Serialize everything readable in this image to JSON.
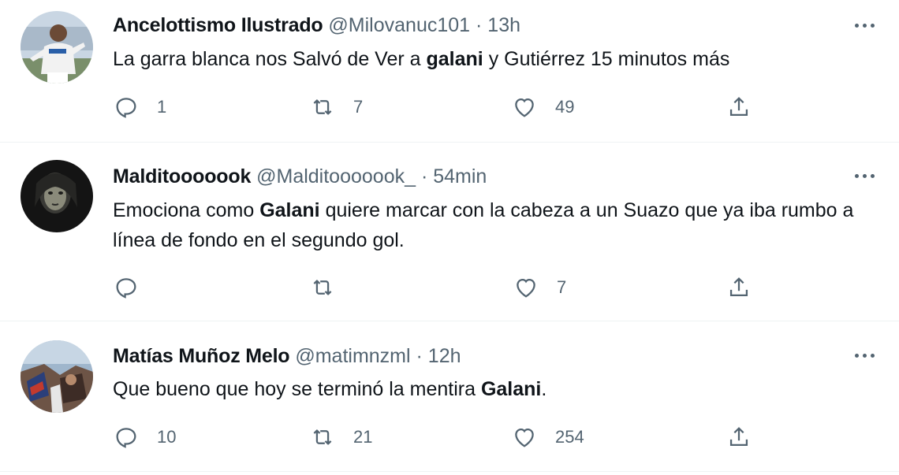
{
  "tweets": [
    {
      "name": "Ancelottismo Ilustrado",
      "handle": "@Milovanuc101",
      "separator": "·",
      "time": "13h",
      "text_before": "La garra blanca nos Salvó de Ver a ",
      "text_bold": "galani",
      "text_after": " y Gutiérrez 15 minutos más",
      "replies": "1",
      "retweets": "7",
      "likes": "49"
    },
    {
      "name": "Malditooooook",
      "handle": "@Malditooooook_",
      "separator": "·",
      "time": "54min",
      "text_before": "Emociona como ",
      "text_bold": "Galani",
      "text_after": " quiere marcar con la cabeza a un Suazo que ya iba rumbo a línea de fondo en el segundo gol.",
      "replies": "",
      "retweets": "",
      "likes": "7"
    },
    {
      "name": "Matías Muñoz Melo",
      "handle": "@matimnzml",
      "separator": "·",
      "time": "12h",
      "text_before": "Que bueno que hoy se terminó la mentira ",
      "text_bold": "Galani",
      "text_after": ".",
      "replies": "10",
      "retweets": "21",
      "likes": "254"
    }
  ],
  "icons": {
    "reply": "reply-icon",
    "retweet": "retweet-icon",
    "like": "heart-icon",
    "share": "share-icon",
    "more": "more-options-icon"
  },
  "colors": {
    "text": "#0f1419",
    "secondary": "#536471",
    "divider": "#eff3f4"
  }
}
